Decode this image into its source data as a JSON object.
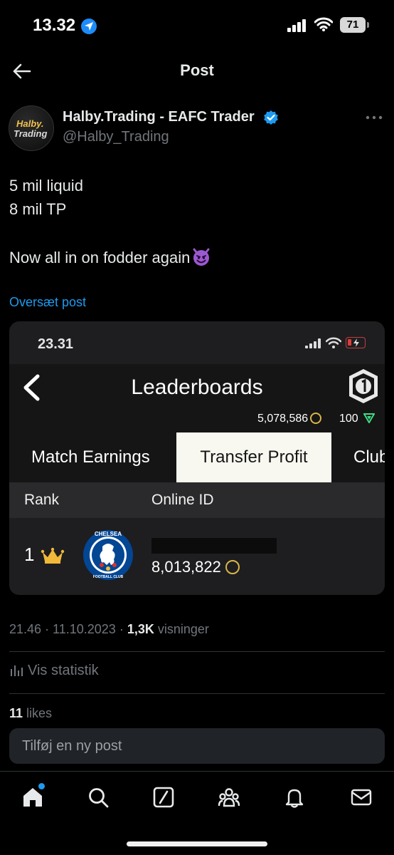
{
  "status_bar": {
    "time": "13.32",
    "battery": "71"
  },
  "header": {
    "title": "Post"
  },
  "author": {
    "avatar_text_line1": "Halby.",
    "avatar_text_line2": "Trading",
    "name": "Halby.Trading - EAFC Trader",
    "handle": "@Halby_Trading"
  },
  "tweet": {
    "lines": [
      "5 mil liquid",
      "8 mil TP",
      "Now all in on fodder again"
    ],
    "emoji": "smiling-imp",
    "translate_label": "Oversæt post"
  },
  "embedded_screenshot": {
    "status_time": "23.31",
    "title": "Leaderboards",
    "coins": "5,078,586",
    "points": "100",
    "tabs": [
      {
        "label": "Match Earnings",
        "active": false
      },
      {
        "label": "Transfer Profit",
        "active": true
      },
      {
        "label": "Club",
        "active": false
      }
    ],
    "columns": {
      "rank": "Rank",
      "online_id": "Online ID"
    },
    "rows": [
      {
        "rank": "1",
        "club_badge_text": "CHELSEA",
        "club_badge_sub": "FOOTBALL CLUB",
        "score": "8,013,822"
      }
    ]
  },
  "meta": {
    "time": "21.46",
    "date": "11.10.2023",
    "views_count": "1,3K",
    "views_label": "visninger"
  },
  "stats_label": "Vis statistik",
  "likes": {
    "count": "11",
    "label": "likes"
  },
  "reply": {
    "placeholder": "Tilføj en ny post"
  },
  "colors": {
    "accent": "#1d9bf0",
    "background": "#000000",
    "muted": "#71767b"
  }
}
